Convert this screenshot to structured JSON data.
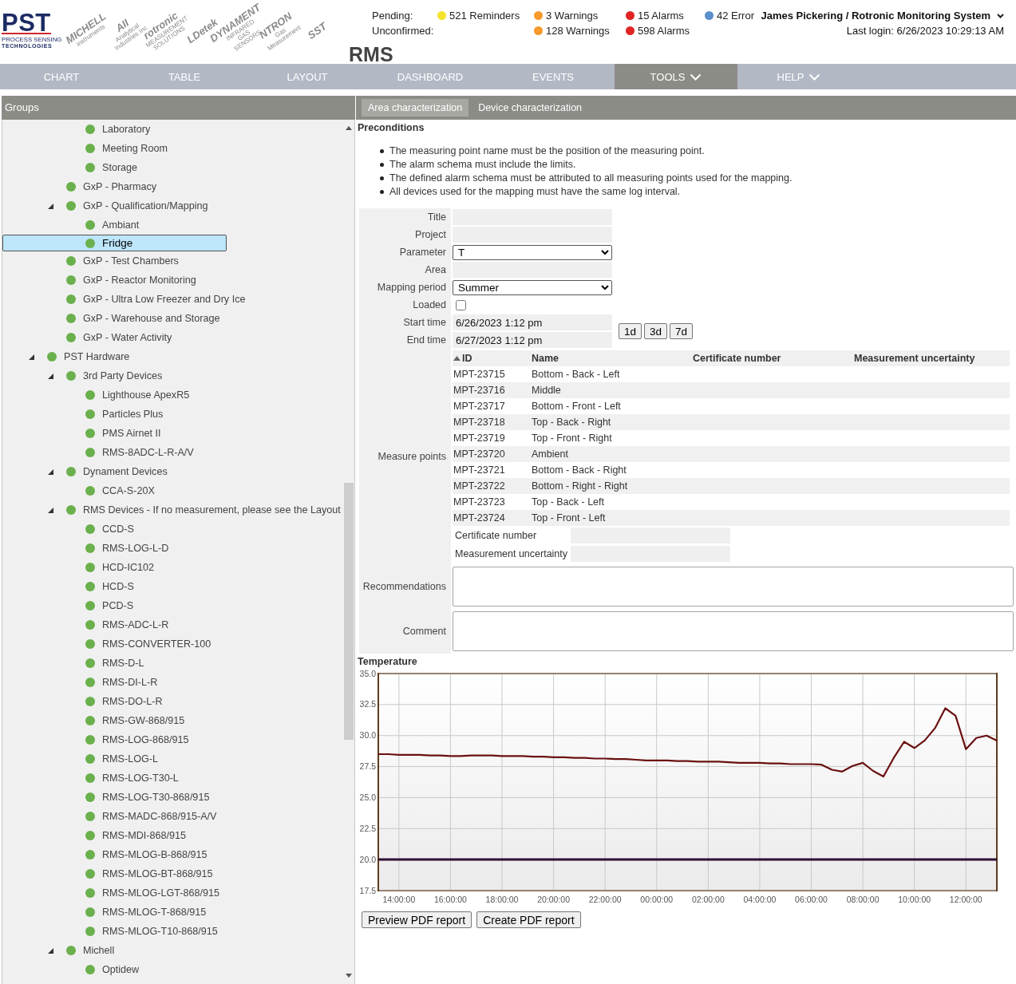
{
  "header": {
    "logo": {
      "name": "PST",
      "subtitle": "PROCESS SENSING",
      "tagline": "TECHNOLOGIES"
    },
    "partner_logos": [
      {
        "name": "MICHELL",
        "tagline": "instruments"
      },
      {
        "name": "AII",
        "tagline": "Analytical Industries Inc"
      },
      {
        "name": "rotronic",
        "tagline": "MEASUREMENT SOLUTIONS"
      },
      {
        "name": "LDetek"
      },
      {
        "name": "DYNAMENT",
        "tagline": "INFRARED GAS SENSORS"
      },
      {
        "name": "NTRON",
        "tagline": "Gas Measurement"
      },
      {
        "name": "SST"
      }
    ],
    "app_title": "RMS",
    "status": [
      {
        "label": "Pending:",
        "items": [
          {
            "kind": "reminders",
            "text": "521 Reminders",
            "color": "#f4e32a"
          },
          {
            "kind": "warnings",
            "text": "3 Warnings",
            "color": "#f5992a"
          },
          {
            "kind": "alarms",
            "text": "15 Alarms",
            "color": "#e02424"
          },
          {
            "kind": "errors",
            "text": "42 Error",
            "color": "#5a8fcb"
          }
        ]
      },
      {
        "label": "Unconfirmed:",
        "items": [
          {
            "kind": "warnings",
            "text": "128 Warnings",
            "color": "#f5992a"
          },
          {
            "kind": "alarms",
            "text": "598 Alarms",
            "color": "#e02424"
          }
        ]
      }
    ],
    "user": {
      "name": "James Pickering / Rotronic Monitoring System",
      "last_login": "Last login: 6/26/2023 10:29:13 AM"
    }
  },
  "nav": [
    {
      "label": "CHART",
      "selected": false,
      "dropdown": false
    },
    {
      "label": "TABLE",
      "selected": false,
      "dropdown": false
    },
    {
      "label": "LAYOUT",
      "selected": false,
      "dropdown": false
    },
    {
      "label": "DASHBOARD",
      "selected": false,
      "dropdown": false
    },
    {
      "label": "EVENTS",
      "selected": false,
      "dropdown": false
    },
    {
      "label": "TOOLS",
      "selected": true,
      "dropdown": true
    },
    {
      "label": "HELP",
      "selected": false,
      "dropdown": true
    }
  ],
  "groups": {
    "title": "Groups",
    "tree": [
      {
        "children": [
          {
            "children": [
              {
                "label": "Laboratory",
                "selected": false
              },
              {
                "label": "Meeting Room",
                "selected": false
              },
              {
                "label": "Storage",
                "selected": false
              }
            ]
          },
          {
            "label": "GxP - Pharmacy",
            "selected": false
          },
          {
            "label": "GxP - Qualification/Mapping",
            "selected": false,
            "expanded": true,
            "children": [
              {
                "label": "Ambiant",
                "selected": false
              },
              {
                "label": "Fridge",
                "selected": true
              }
            ]
          },
          {
            "label": "GxP - Test Chambers",
            "selected": false
          },
          {
            "label": "GxP - Reactor Monitoring",
            "selected": false
          },
          {
            "label": "GxP - Ultra Low Freezer and Dry Ice",
            "selected": false
          },
          {
            "label": "GxP - Warehouse and Storage",
            "selected": false
          },
          {
            "label": "GxP - Water Activity",
            "selected": false
          }
        ]
      },
      {
        "label": "PST Hardware",
        "selected": false,
        "expanded": true,
        "children": [
          {
            "label": "3rd Party Devices",
            "selected": false,
            "expanded": true,
            "children": [
              {
                "label": "Lighthouse ApexR5",
                "selected": false
              },
              {
                "label": "Particles Plus",
                "selected": false
              },
              {
                "label": "PMS Airnet II",
                "selected": false
              },
              {
                "label": "RMS-8ADC-L-R-A/V",
                "selected": false
              }
            ]
          },
          {
            "label": "Dynament Devices",
            "selected": false,
            "expanded": true,
            "children": [
              {
                "label": "CCA-S-20X",
                "selected": false
              }
            ]
          },
          {
            "label": "RMS Devices - If no measurement, please see the Layout",
            "selected": false,
            "expanded": true,
            "children": [
              {
                "label": "CCD-S",
                "selected": false
              },
              {
                "label": "RMS-LOG-L-D",
                "selected": false
              },
              {
                "label": "HCD-IC102",
                "selected": false
              },
              {
                "label": "HCD-S",
                "selected": false
              },
              {
                "label": "PCD-S",
                "selected": false
              },
              {
                "label": "RMS-ADC-L-R",
                "selected": false
              },
              {
                "label": "RMS-CONVERTER-100",
                "selected": false
              },
              {
                "label": "RMS-D-L",
                "selected": false
              },
              {
                "label": "RMS-DI-L-R",
                "selected": false
              },
              {
                "label": "RMS-DO-L-R",
                "selected": false
              },
              {
                "label": "RMS-GW-868/915",
                "selected": false
              },
              {
                "label": "RMS-LOG-868/915",
                "selected": false
              },
              {
                "label": "RMS-LOG-L",
                "selected": false
              },
              {
                "label": "RMS-LOG-T30-L",
                "selected": false
              },
              {
                "label": "RMS-LOG-T30-868/915",
                "selected": false
              },
              {
                "label": "RMS-MADC-868/915-A/V",
                "selected": false
              },
              {
                "label": "RMS-MDI-868/915",
                "selected": false
              },
              {
                "label": "RMS-MLOG-B-868/915",
                "selected": false
              },
              {
                "label": "RMS-MLOG-BT-868/915",
                "selected": false
              },
              {
                "label": "RMS-MLOG-LGT-868/915",
                "selected": false
              },
              {
                "label": "RMS-MLOG-T-868/915",
                "selected": false
              },
              {
                "label": "RMS-MLOG-T10-868/915",
                "selected": false
              }
            ]
          },
          {
            "label": "Michell",
            "selected": false,
            "expanded": true,
            "children": [
              {
                "label": "Optidew",
                "selected": false
              }
            ]
          }
        ]
      }
    ]
  },
  "tabs": [
    {
      "label": "Area characterization",
      "selected": true
    },
    {
      "label": "Device characterization",
      "selected": false
    }
  ],
  "preconditions": {
    "title": "Preconditions",
    "items": [
      "The measuring point name must be the position of the measuring point.",
      "The alarm schema must include the limits.",
      "The defined alarm schema must be attributed to all measuring points used for the mapping.",
      "All devices used for the mapping must have the same log interval."
    ]
  },
  "form": {
    "fields": [
      {
        "kind": "text",
        "label": "Title"
      },
      {
        "kind": "text",
        "label": "Project"
      },
      {
        "kind": "select",
        "label": "Parameter",
        "value": "T"
      },
      {
        "kind": "text",
        "label": "Area"
      },
      {
        "kind": "select",
        "label": "Mapping period",
        "value": "Summer"
      },
      {
        "kind": "checkbox",
        "label": "Loaded",
        "checked": false
      }
    ],
    "time_range": {
      "fields": [
        {
          "label": "Start time",
          "value": "6/26/2023 1:12 pm"
        },
        {
          "label": "End time",
          "value": "6/27/2023 1:12 pm"
        }
      ],
      "buttons": [
        "1d",
        "3d",
        "7d"
      ]
    },
    "measure_points": {
      "label": "Measure points",
      "columns": [
        {
          "label": "ID",
          "sorted": true
        },
        {
          "label": "Name",
          "sorted": false
        },
        {
          "label": "Certificate number",
          "sorted": false
        },
        {
          "label": "Measurement uncertainty",
          "sorted": false
        }
      ],
      "rows": [
        [
          "MPT-23715",
          "Bottom - Back - Left"
        ],
        [
          "MPT-23716",
          "Middle"
        ],
        [
          "MPT-23717",
          "Bottom - Front - Left"
        ],
        [
          "MPT-23718",
          "Top - Back - Right"
        ],
        [
          "MPT-23719",
          "Top - Front - Right"
        ],
        [
          "MPT-23720",
          "Ambient"
        ],
        [
          "MPT-23721",
          "Bottom - Back - Right"
        ],
        [
          "MPT-23722",
          "Bottom - Right - Right"
        ],
        [
          "MPT-23723",
          "Top - Back - Left"
        ],
        [
          "MPT-23724",
          "Top - Front - Left"
        ]
      ],
      "extra_fields": [
        {
          "label": "Certificate number"
        },
        {
          "label": "Measurement uncertainty"
        }
      ]
    },
    "notes": [
      {
        "label": "Recommendations"
      },
      {
        "label": "Comment"
      }
    ]
  },
  "chart": {
    "chart_data": {
      "type": "line",
      "title": "Temperature",
      "grid": true,
      "categories": [
        null,
        null,
        "14:00:00",
        null,
        null,
        null,
        null,
        "16:00:00",
        null,
        null,
        null,
        null,
        "18:00:00",
        null,
        null,
        null,
        null,
        "20:00:00",
        null,
        null,
        null,
        null,
        "22:00:00",
        null,
        null,
        null,
        null,
        "00:00:00",
        null,
        null,
        null,
        null,
        "02:00:00",
        null,
        null,
        null,
        null,
        "04:00:00",
        null,
        null,
        null,
        null,
        "06:00:00",
        null,
        null,
        null,
        null,
        "08:00:00",
        null,
        null,
        null,
        null,
        "10:00:00",
        null,
        null,
        null,
        null,
        "12:00:00",
        null,
        null,
        null
      ],
      "series": [
        {
          "color": "#6b1010",
          "values": [
            28.5,
            28.5,
            28.45,
            28.45,
            28.45,
            28.4,
            28.4,
            28.35,
            28.35,
            28.4,
            28.4,
            28.4,
            28.35,
            28.35,
            28.35,
            28.3,
            28.3,
            28.25,
            28.25,
            28.2,
            28.2,
            28.15,
            28.15,
            28.1,
            28.1,
            28.05,
            28.0,
            28.0,
            28.0,
            27.95,
            27.95,
            27.9,
            27.9,
            27.9,
            27.85,
            27.8,
            27.8,
            27.8,
            27.75,
            27.75,
            27.7,
            27.7,
            27.7,
            27.65,
            27.25,
            27.1,
            27.55,
            27.8,
            27.15,
            26.7,
            28.2,
            29.5,
            29.0,
            29.6,
            30.6,
            32.2,
            31.6,
            28.9,
            29.8,
            30.0,
            29.6
          ]
        },
        {
          "color": "#2e0f33",
          "values": [
            20.0,
            20.0,
            20.0,
            20.0,
            20.0,
            20.0,
            20.0,
            20.0,
            20.0,
            20.0,
            20.0,
            20.0,
            20.0,
            20.0,
            20.0,
            20.0,
            20.0,
            20.0,
            20.0,
            20.0,
            20.0,
            20.0,
            20.0,
            20.0,
            20.0,
            20.0,
            20.0,
            20.0,
            20.0,
            20.0,
            20.0,
            20.0,
            20.0,
            20.0,
            20.0,
            20.0,
            20.0,
            20.0,
            20.0,
            20.0,
            20.0,
            20.0,
            20.0,
            20.0,
            20.0,
            20.0,
            20.0,
            20.0,
            20.0,
            20.0,
            20.0,
            20.0,
            20.0,
            20.0,
            20.0,
            20.0,
            20.0,
            20.0,
            20.0,
            20.0,
            20.0
          ]
        }
      ],
      "ylim": [
        17.5,
        35
      ],
      "yticks": [
        {
          "value": 17.5,
          "label": "17.5"
        },
        {
          "value": 20,
          "label": "20.0"
        },
        {
          "value": 22.5,
          "label": "22.5"
        },
        {
          "value": 25,
          "label": "25.0"
        },
        {
          "value": 27.5,
          "label": "27.5"
        },
        {
          "value": 30,
          "label": "30.0"
        },
        {
          "value": 32.5,
          "label": "32.5"
        },
        {
          "value": 35,
          "label": "35.0"
        }
      ]
    }
  },
  "report_buttons": [
    "Preview PDF report",
    "Create PDF report"
  ]
}
